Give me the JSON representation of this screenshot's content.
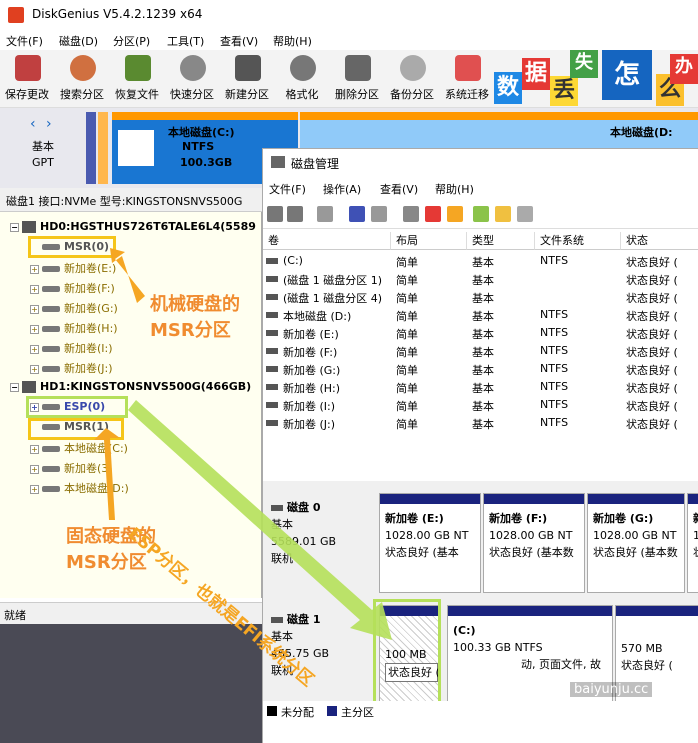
{
  "app": {
    "title": "DiskGenius V5.4.2.1239 x64"
  },
  "menu": [
    "文件(F)",
    "磁盘(D)",
    "分区(P)",
    "工具(T)",
    "查看(V)",
    "帮助(H)"
  ],
  "toolbar": [
    {
      "label": "保存更改",
      "icon": "save-icon",
      "color": "#c04040"
    },
    {
      "label": "搜索分区",
      "icon": "search-icon",
      "color": "#d07040"
    },
    {
      "label": "恢复文件",
      "icon": "recover-icon",
      "color": "#5a8a30"
    },
    {
      "label": "快速分区",
      "icon": "disk-icon",
      "color": "#888888"
    },
    {
      "label": "新建分区",
      "icon": "layers-icon",
      "color": "#555555"
    },
    {
      "label": "格式化",
      "icon": "format-icon",
      "color": "#777777"
    },
    {
      "label": "删除分区",
      "icon": "trash-icon",
      "color": "#666666"
    },
    {
      "label": "备份分区",
      "icon": "backup-icon",
      "color": "#aaaaaa"
    },
    {
      "label": "系统迁移",
      "icon": "migrate-icon",
      "color": "#e05050"
    }
  ],
  "banner": {
    "chars": [
      "数",
      "据",
      "丢",
      "失",
      "怎",
      "么",
      "办"
    ],
    "colors": [
      "#1e88e5",
      "#e53935",
      "#fdd835",
      "#43a047",
      "#1565c0",
      "#fbc02d",
      "#e53935"
    ]
  },
  "diskstrip": {
    "side_label": "基本",
    "side_sub": "GPT",
    "part_c_name": "本地磁盘(C:)",
    "part_c_fs": "NTFS",
    "part_c_size": "100.3GB",
    "part_d_name": "本地磁盘(D:"
  },
  "diskinfo": "磁盘1 接口:NVMe  型号:KINGSTONSNVS500G",
  "tree": {
    "hd0": "HD0:HGSTHUS726T6TALE6L4(5589",
    "hd0_items": [
      "MSR(0)",
      "新加卷(E:)",
      "新加卷(F:)",
      "新加卷(G:)",
      "新加卷(H:)",
      "新加卷(I:)",
      "新加卷(J:)"
    ],
    "hd1": "HD1:KINGSTONSNVS500G(466GB)",
    "hd1_items": [
      "ESP(0)",
      "MSR(1)",
      "本地磁盘(C:)",
      "新加卷(3)",
      "本地磁盘(D:)"
    ]
  },
  "status": "就绪",
  "annotations": {
    "hdd_msr_line1": "机械硬盘的",
    "hdd_msr_line2": "MSR分区",
    "ssd_msr_line1": "固态硬盘的",
    "ssd_msr_line2": "MSR分区",
    "esp_note": "ESP分区，也就是EFI系统分区"
  },
  "dm": {
    "title": "磁盘管理",
    "menu": [
      "文件(F)",
      "操作(A)",
      "查看(V)",
      "帮助(H)"
    ],
    "columns": [
      "卷",
      "布局",
      "类型",
      "文件系统",
      "状态"
    ],
    "rows": [
      [
        "(C:)",
        "简单",
        "基本",
        "NTFS",
        "状态良好 ("
      ],
      [
        "(磁盘 1 磁盘分区 1)",
        "简单",
        "基本",
        "",
        "状态良好 ("
      ],
      [
        "(磁盘 1 磁盘分区 4)",
        "简单",
        "基本",
        "",
        "状态良好 ("
      ],
      [
        "本地磁盘 (D:)",
        "简单",
        "基本",
        "NTFS",
        "状态良好 ("
      ],
      [
        "新加卷 (E:)",
        "简单",
        "基本",
        "NTFS",
        "状态良好 ("
      ],
      [
        "新加卷 (F:)",
        "简单",
        "基本",
        "NTFS",
        "状态良好 ("
      ],
      [
        "新加卷 (G:)",
        "简单",
        "基本",
        "NTFS",
        "状态良好 ("
      ],
      [
        "新加卷 (H:)",
        "简单",
        "基本",
        "NTFS",
        "状态良好 ("
      ],
      [
        "新加卷 (I:)",
        "简单",
        "基本",
        "NTFS",
        "状态良好 ("
      ],
      [
        "新加卷 (J:)",
        "简单",
        "基本",
        "NTFS",
        "状态良好 ("
      ]
    ],
    "disk0": {
      "name": "磁盘 0",
      "type": "基本",
      "size": "5589.01 GB",
      "state": "联机",
      "parts": [
        {
          "name": "新加卷 (E:)",
          "size": "1028.00 GB NT",
          "status": "状态良好 (基本"
        },
        {
          "name": "新加卷 (F:)",
          "size": "1028.00 GB NT",
          "status": "状态良好 (基本数"
        },
        {
          "name": "新加卷 (G:)",
          "size": "1028.00 GB NT",
          "status": "状态良好 (基本数"
        },
        {
          "name": "新",
          "size": "10",
          "status": "状"
        }
      ]
    },
    "disk1": {
      "name": "磁盘 1",
      "type": "基本",
      "size": "465.75 GB",
      "state": "联机",
      "esp": {
        "size": "100 MB",
        "status": "状态良好 (EFI 系统分区)"
      },
      "c": {
        "name": "(C:)",
        "size": "100.33 GB NTFS",
        "status": "动, 页面文件, 故"
      },
      "d": {
        "size": "570 MB",
        "status": "状态良好 ("
      }
    },
    "legend": [
      "未分配",
      "主分区"
    ]
  },
  "watermark": "baiyunju.cc"
}
